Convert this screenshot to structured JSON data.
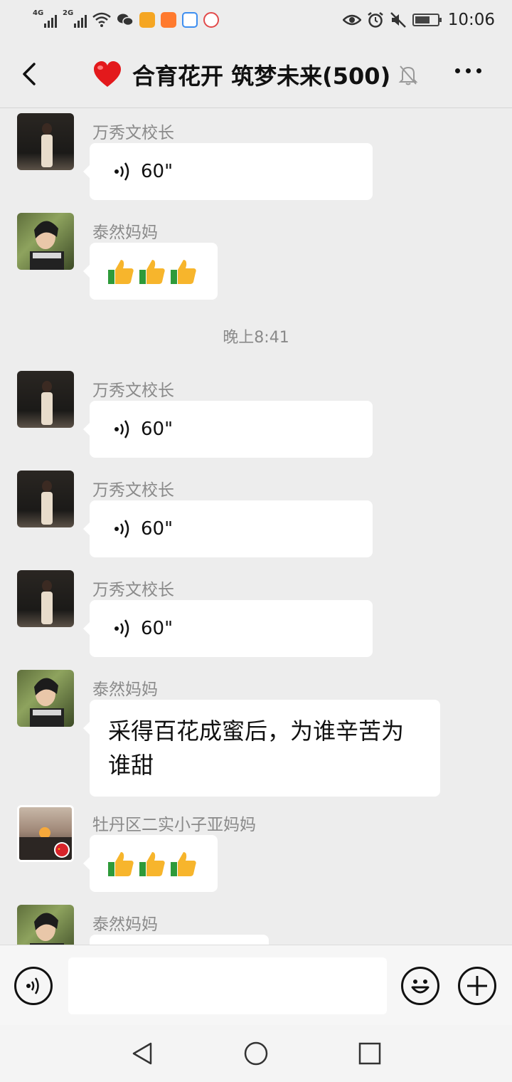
{
  "status_bar": {
    "network1": "4G",
    "network2": "2G",
    "time": "10:06"
  },
  "header": {
    "title": "合育花开 筑梦未来(500)",
    "icons": [
      "back-icon",
      "heart-emoji",
      "mute-bell-icon",
      "more-icon"
    ]
  },
  "messages": [
    {
      "sender": "万秀文校长",
      "type": "voice",
      "duration": "60\""
    },
    {
      "sender": "泰然妈妈",
      "type": "emoji",
      "emoji": "👍👍👍"
    },
    {
      "sender": "万秀文校长",
      "type": "voice",
      "duration": "60\""
    },
    {
      "sender": "万秀文校长",
      "type": "voice",
      "duration": "60\""
    },
    {
      "sender": "万秀文校长",
      "type": "voice",
      "duration": "60\""
    },
    {
      "sender": "泰然妈妈",
      "type": "text",
      "text": "采得百花成蜜后，为谁辛苦为谁甜"
    },
    {
      "sender": "牡丹区二实小子亚妈妈",
      "type": "emoji",
      "emoji": "👍👍👍"
    },
    {
      "sender": "泰然妈妈",
      "type": "partial"
    }
  ],
  "timestamp": "晚上8:41",
  "input_bar": {
    "value": "",
    "icons": [
      "voice-mode-icon",
      "emoji-icon",
      "plus-icon"
    ]
  },
  "colors": {
    "background": "#ededed",
    "bubble": "#ffffff",
    "secondary_text": "#8a8a8a"
  }
}
